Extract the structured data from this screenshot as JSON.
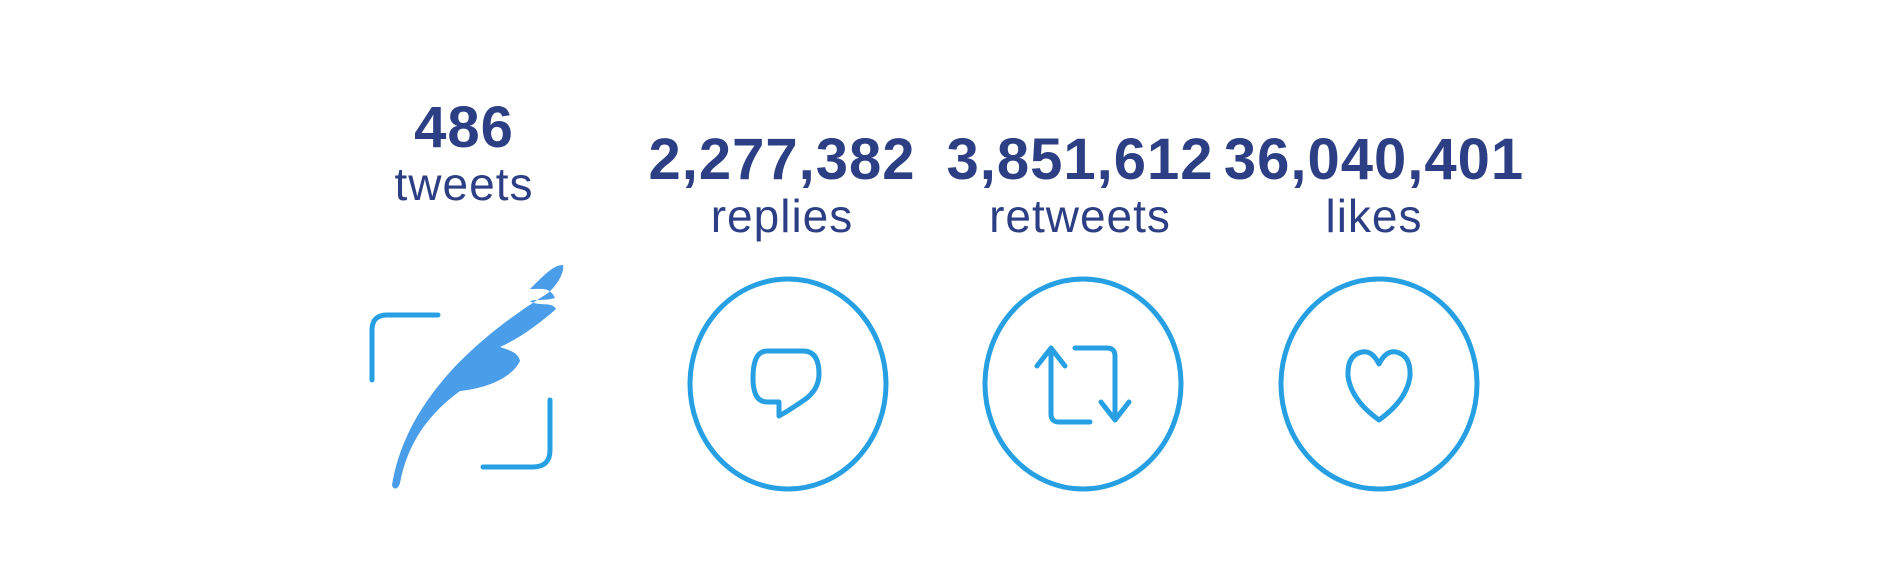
{
  "colors": {
    "number_text": "#2c3f84",
    "icon_blue": "#27a0e3",
    "quill_blue": "#4a9de8"
  },
  "stats": {
    "tweets": {
      "count": "486",
      "label": "tweets",
      "icon": "quill-icon"
    },
    "replies": {
      "count": "2,277,382",
      "label": "replies",
      "icon": "reply-bubble-icon"
    },
    "retweets": {
      "count": "3,851,612",
      "label": "retweets",
      "icon": "retweet-arrows-icon"
    },
    "likes": {
      "count": "36,040,401",
      "label": "likes",
      "icon": "heart-icon"
    }
  }
}
